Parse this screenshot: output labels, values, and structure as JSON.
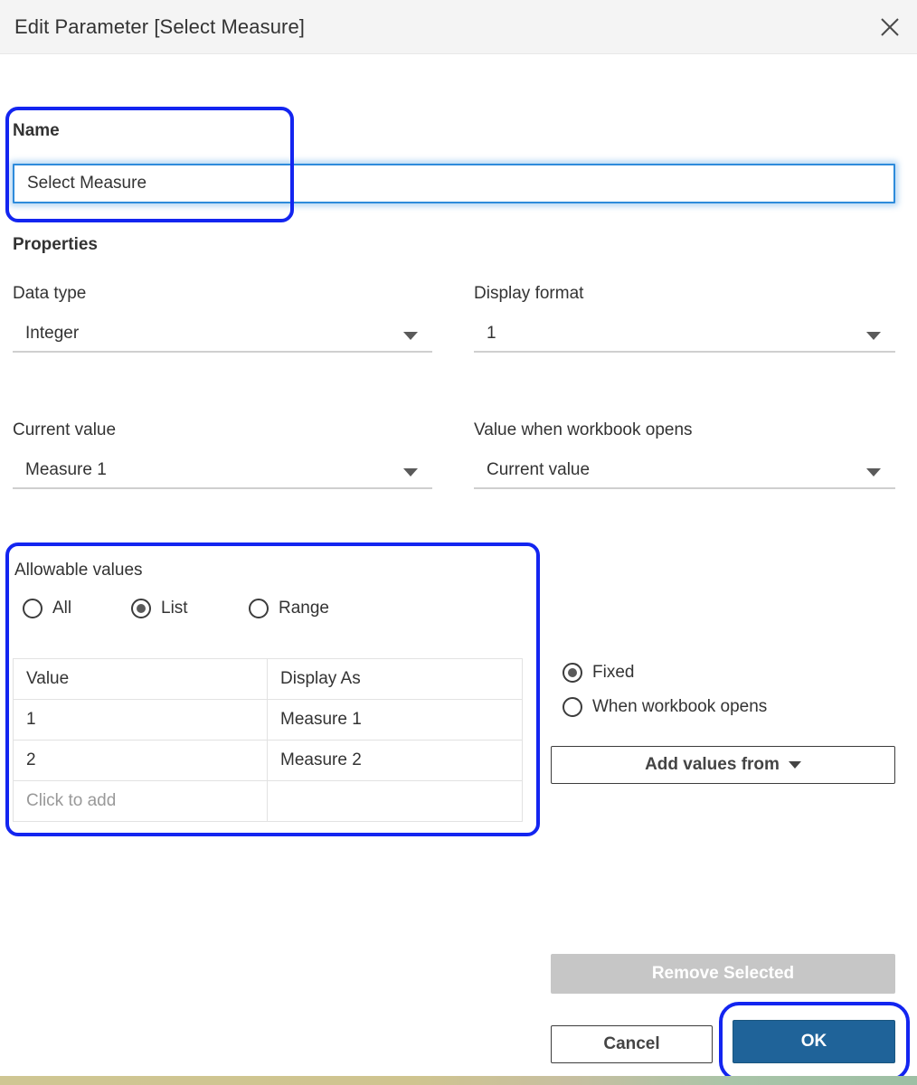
{
  "window": {
    "title": "Edit Parameter [Select Measure]",
    "close_icon": "close-icon"
  },
  "name_section": {
    "label": "Name",
    "value": "Select Measure",
    "placeholder": ""
  },
  "properties": {
    "heading": "Properties",
    "data_type": {
      "label": "Data type",
      "value": "Integer"
    },
    "display_format": {
      "label": "Display format",
      "value": "1"
    },
    "current_value": {
      "label": "Current value",
      "value": "Measure 1"
    },
    "value_when_workbook_opens": {
      "label": "Value when workbook opens",
      "value": "Current value"
    }
  },
  "allowable_values": {
    "heading": "Allowable values",
    "options": [
      {
        "label": "All",
        "selected": false
      },
      {
        "label": "List",
        "selected": true
      },
      {
        "label": "Range",
        "selected": false
      }
    ],
    "table": {
      "headers": [
        "Value",
        "Display As"
      ],
      "rows": [
        [
          "1",
          "Measure 1"
        ],
        [
          "2",
          "Measure 2"
        ]
      ],
      "add_row_placeholder": "Click to add"
    }
  },
  "value_source": {
    "options": [
      {
        "label": "Fixed",
        "selected": true
      },
      {
        "label": "When workbook opens",
        "selected": false
      }
    ],
    "add_values_from_label": "Add values from"
  },
  "actions": {
    "remove_selected": "Remove Selected",
    "cancel": "Cancel",
    "ok": "OK"
  },
  "colors": {
    "annotation": "#1325f0",
    "primary_button": "#1f6399",
    "disabled_button": "#c6c6c6",
    "focus_border": "#2e8bdb",
    "titlebar_bg": "#f4f4f4"
  }
}
